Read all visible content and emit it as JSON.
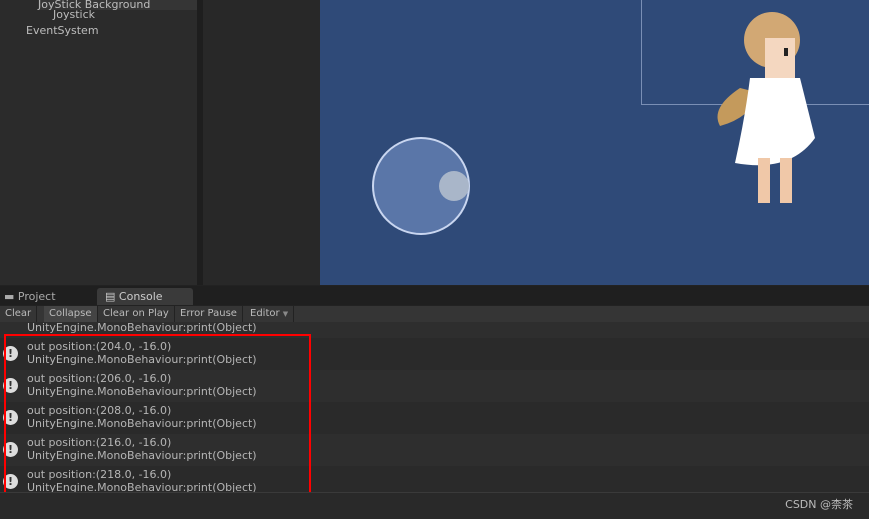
{
  "hierarchy": {
    "items": [
      "JoyStick Background",
      "Joystick",
      "EventSystem"
    ]
  },
  "tabs": [
    {
      "label": "Project",
      "icon": "folder-icon"
    },
    {
      "label": "Console",
      "icon": "console-icon"
    }
  ],
  "toolbar": [
    "Clear",
    "Collapse",
    "Clear on Play",
    "Error Pause",
    "Editor"
  ],
  "console": {
    "partial_line": "UnityEngine.MonoBehaviour:print(Object)",
    "entries": [
      {
        "message": "out position:(204.0, -16.0)",
        "trace": "UnityEngine.MonoBehaviour:print(Object)"
      },
      {
        "message": "out position:(206.0, -16.0)",
        "trace": "UnityEngine.MonoBehaviour:print(Object)"
      },
      {
        "message": "out position:(208.0, -16.0)",
        "trace": "UnityEngine.MonoBehaviour:print(Object)"
      },
      {
        "message": "out position:(216.0, -16.0)",
        "trace": "UnityEngine.MonoBehaviour:print(Object)"
      },
      {
        "message": "out position:(218.0, -16.0)",
        "trace": "UnityEngine.MonoBehaviour:print(Object)"
      }
    ]
  },
  "watermark": "CSDN @柰茶",
  "colors": {
    "highlight": "#ff0000",
    "game_bg": "#2f4a78"
  }
}
